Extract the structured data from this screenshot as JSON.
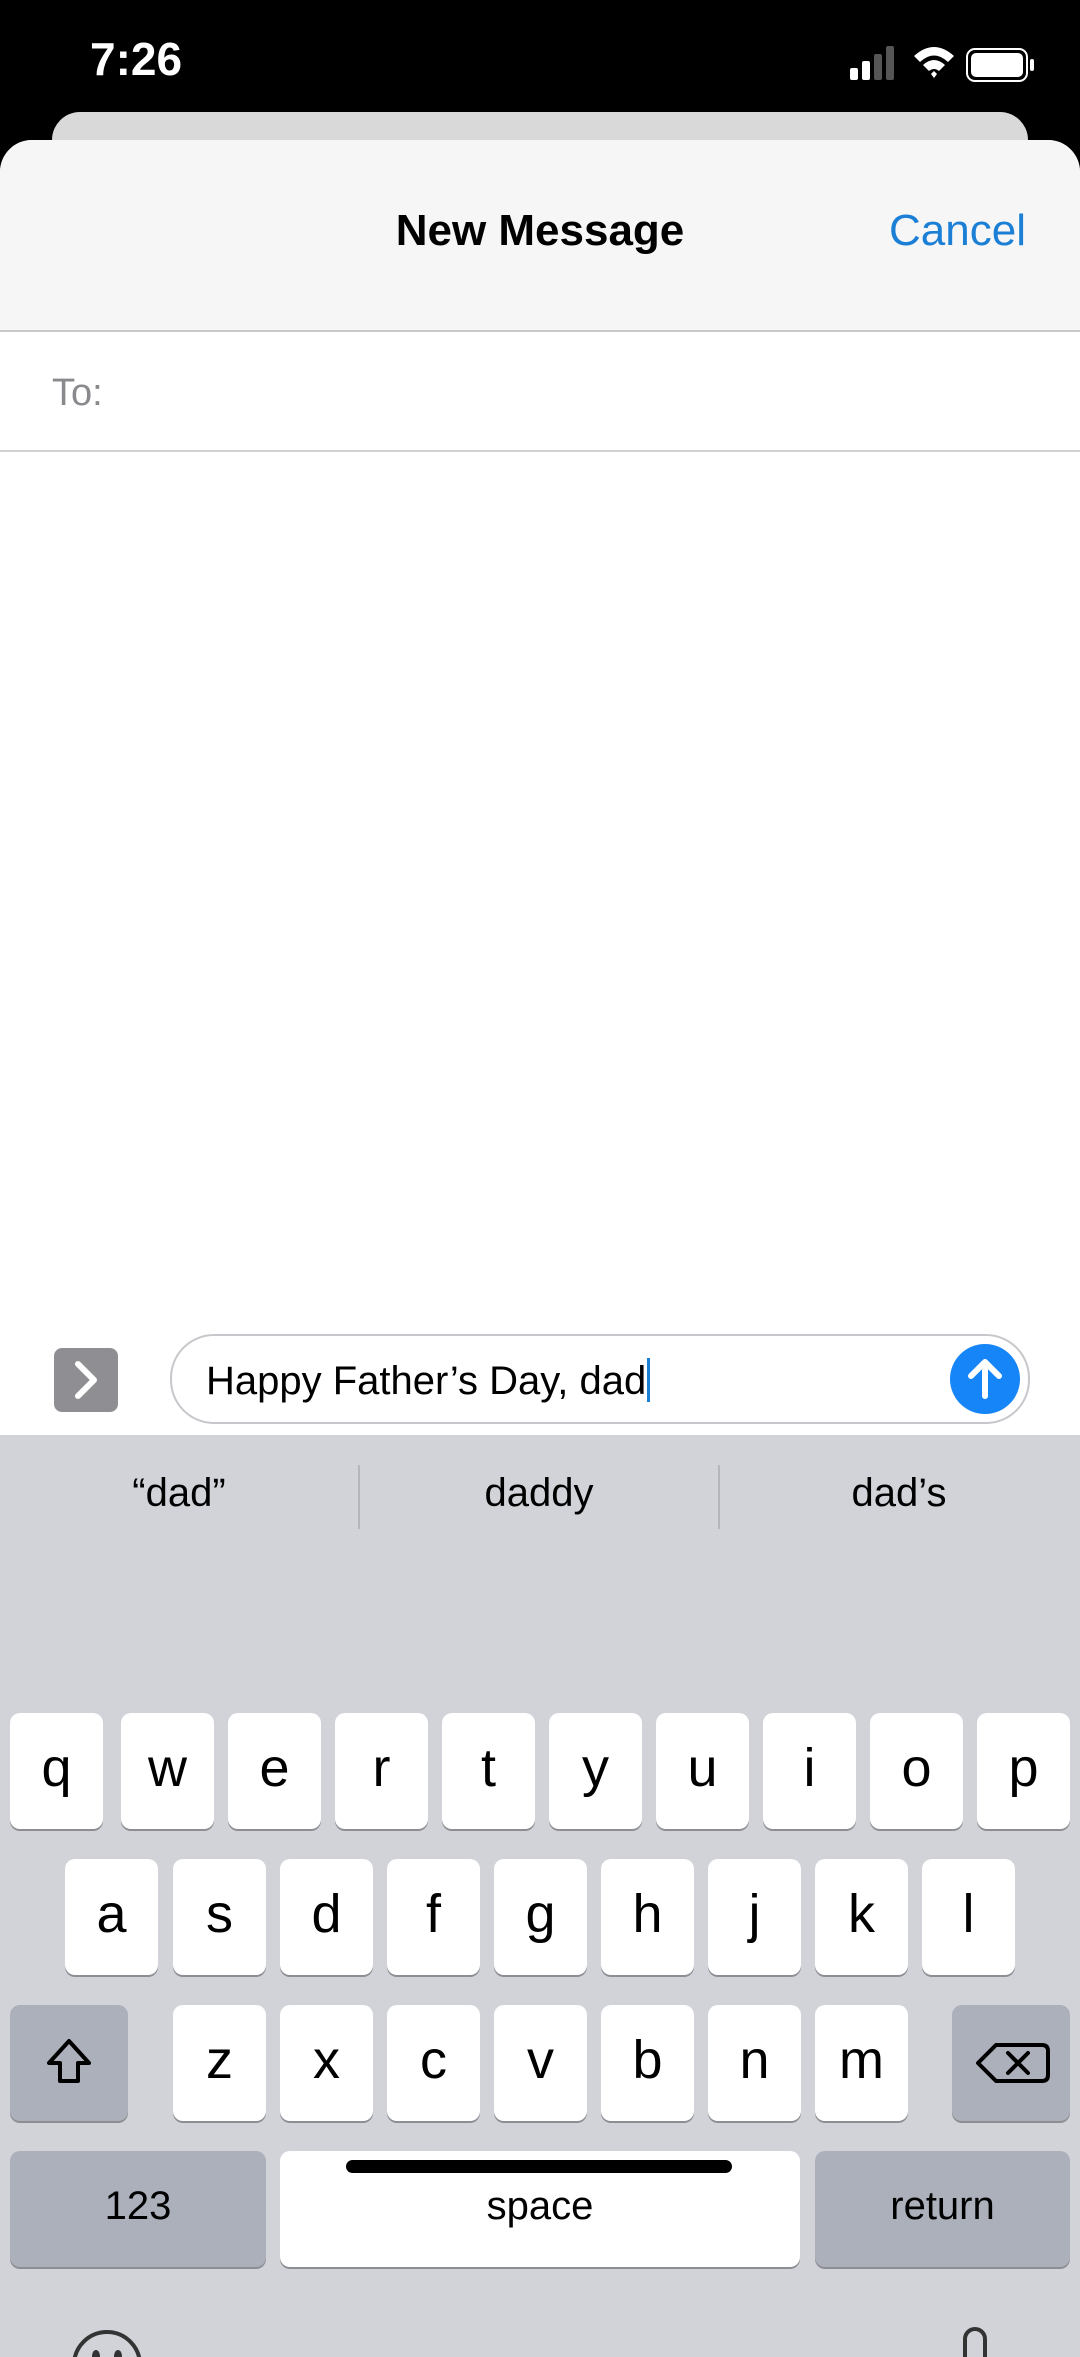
{
  "status": {
    "time": "7:26"
  },
  "header": {
    "title": "New Message",
    "cancel_label": "Cancel"
  },
  "recipient": {
    "label": "To:",
    "value": ""
  },
  "compose": {
    "message": "Happy Father’s Day, dad"
  },
  "keyboard": {
    "suggestions": [
      "“dad”",
      "daddy",
      "dad’s"
    ],
    "row1": [
      "q",
      "w",
      "e",
      "r",
      "t",
      "y",
      "u",
      "i",
      "o",
      "p"
    ],
    "row2": [
      "a",
      "s",
      "d",
      "f",
      "g",
      "h",
      "j",
      "k",
      "l"
    ],
    "row3": [
      "z",
      "x",
      "c",
      "v",
      "b",
      "n",
      "m"
    ],
    "numbers_label": "123",
    "space_label": "space",
    "return_label": "return"
  },
  "icons": [
    "signal-icon",
    "wifi-icon",
    "battery-icon",
    "apps-chevron-icon",
    "send-arrow-icon",
    "shift-icon",
    "delete-icon",
    "emoji-icon",
    "microphone-icon"
  ],
  "colors": {
    "accent": "#1c7fd6",
    "send": "#1685f7",
    "keyboard_bg": "#d1d3d9"
  }
}
